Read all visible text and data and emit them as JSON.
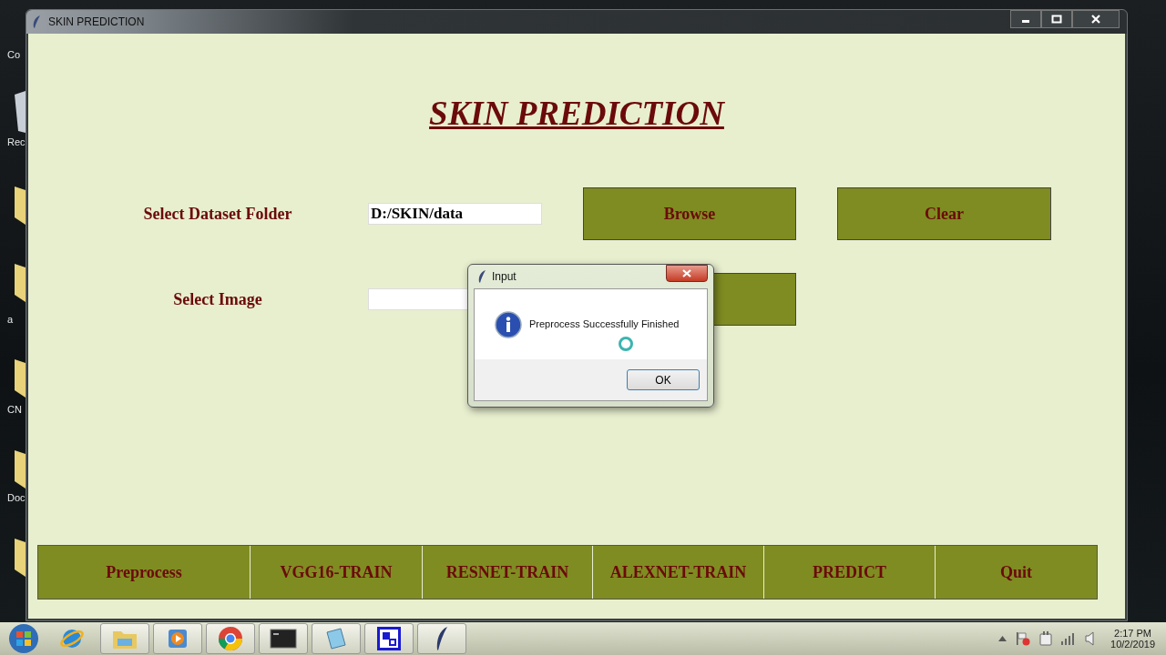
{
  "desktop_icons": [
    {
      "label": "Co"
    },
    {
      "label": "Rec"
    },
    {
      "label": "a"
    },
    {
      "label": "CN"
    },
    {
      "label": "Doc"
    }
  ],
  "window": {
    "title": "SKIN PREDICTION"
  },
  "heading": "SKIN PREDICTION",
  "form": [
    {
      "label": "Select Dataset Folder",
      "value": "D:/SKIN/data",
      "buttons": [
        {
          "kind": "button",
          "label": "Browse"
        },
        {
          "kind": "button",
          "label": "Clear"
        }
      ]
    },
    {
      "label": "Select Image",
      "buttons": [
        {
          "kind": "button"
        }
      ]
    }
  ],
  "actions": [
    {
      "label": "Preprocess"
    },
    {
      "label": "VGG16-TRAIN"
    },
    {
      "label": "RESNET-TRAIN"
    },
    {
      "label": "ALEXNET-TRAIN"
    },
    {
      "label": "PREDICT"
    },
    {
      "label": "Quit"
    }
  ],
  "dialog": {
    "title": "Input",
    "message": "Preprocess Successfully Finished",
    "buttons": [
      "OK"
    ]
  },
  "clock": {
    "time": "2:17 PM",
    "date": "10/2/2019"
  }
}
